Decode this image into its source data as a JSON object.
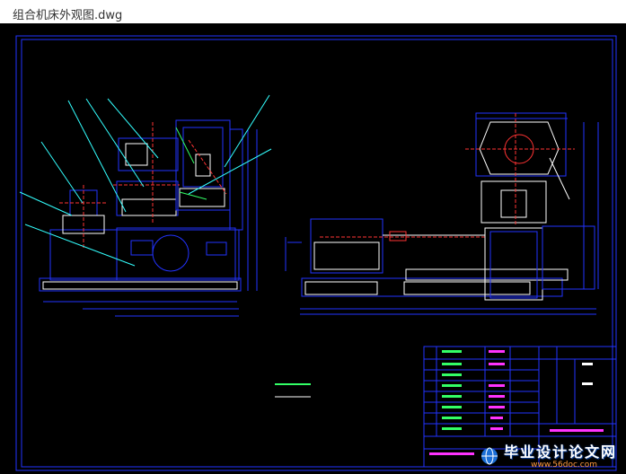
{
  "window": {
    "title": "组合机床外观图.dwg"
  },
  "colors": {
    "frame": "#2233ff",
    "line": "#ffffff",
    "center": "#ff3333",
    "cyan": "#33ffff",
    "green": "#33ff66",
    "magenta": "#ff33ff",
    "yellow": "#ffff33"
  },
  "watermark": {
    "main": "毕业设计论文网",
    "url": "www.56doc.com",
    "logo_icon": "globe-logo-icon"
  }
}
